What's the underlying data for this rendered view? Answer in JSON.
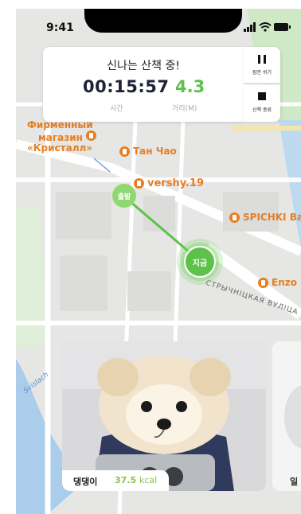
{
  "status_bar": {
    "time": "9:41"
  },
  "walk_card": {
    "title": "신나는 산책 중!",
    "elapsed": "00:15:57",
    "elapsed_label": "시간",
    "distance": "4.3",
    "distance_label": "거리(M)"
  },
  "controls": {
    "pause_label": "잠깐 쉬기",
    "stop_label": "산책 종료"
  },
  "map": {
    "start_label": "출발",
    "now_label": "지금",
    "pois": {
      "store_line1": "Фирменный",
      "store_line2": "магазин",
      "store_line3": "«Кристалл»",
      "tan_chao": "Тан Чао",
      "vershy": "vershy.19",
      "spichki": "SPICHKI Ba",
      "enzo": "Enzo"
    },
    "street": "СТРЫЧНІЦКАЯ ВУЛІЦА",
    "river": "Svislach"
  },
  "dog_cards": [
    {
      "name": "댕댕이",
      "calories": "37.5",
      "unit": "kcal"
    },
    {
      "name_partial": "일"
    }
  ],
  "colors": {
    "accent": "#5cc24a",
    "route": "#5cc24a",
    "poi": "#e67e22"
  }
}
